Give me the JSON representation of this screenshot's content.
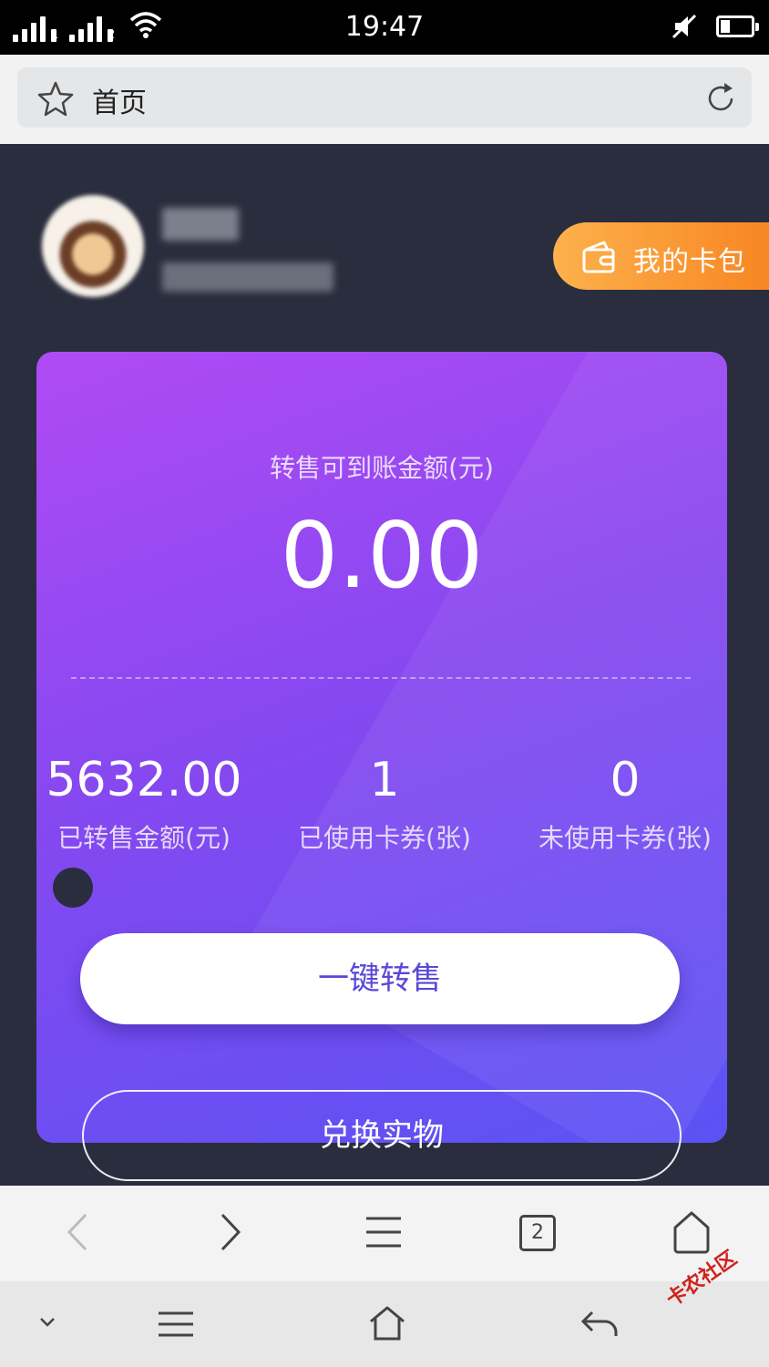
{
  "status_bar": {
    "time": "19:47",
    "sim1": "1",
    "sim2": "2",
    "icons": [
      "signal-icon",
      "wifi-icon",
      "mute-icon",
      "battery-icon"
    ]
  },
  "address_bar": {
    "text": "首页",
    "icons": [
      "star-icon",
      "reload-icon"
    ]
  },
  "user": {
    "wallet_button": "我的卡包"
  },
  "card": {
    "balance_label": "转售可到账金额(元)",
    "balance_value": "0.00",
    "stats": [
      {
        "value": "5632.00",
        "label": "已转售金额(元)"
      },
      {
        "value": "1",
        "label": "已使用卡券(张)"
      },
      {
        "value": "0",
        "label": "未使用卡券(张)"
      }
    ],
    "primary_button": "一键转售"
  },
  "secondary_button": "兑换实物",
  "browser_toolbar": {
    "tab_count": "2",
    "icons": [
      "back-icon",
      "forward-icon",
      "menu-icon",
      "tabs-icon",
      "home-icon"
    ]
  },
  "system_nav": {
    "icons": [
      "collapse-icon",
      "menu-icon",
      "home-icon",
      "back-icon"
    ]
  },
  "watermark": "卡农社区",
  "colors": {
    "page_bg": "#2a2d3d",
    "card_gradient_start": "#b04bf5",
    "card_gradient_end": "#5a53f4",
    "wallet_orange": "#f7821f",
    "primary_button_text": "#5a47d6"
  }
}
